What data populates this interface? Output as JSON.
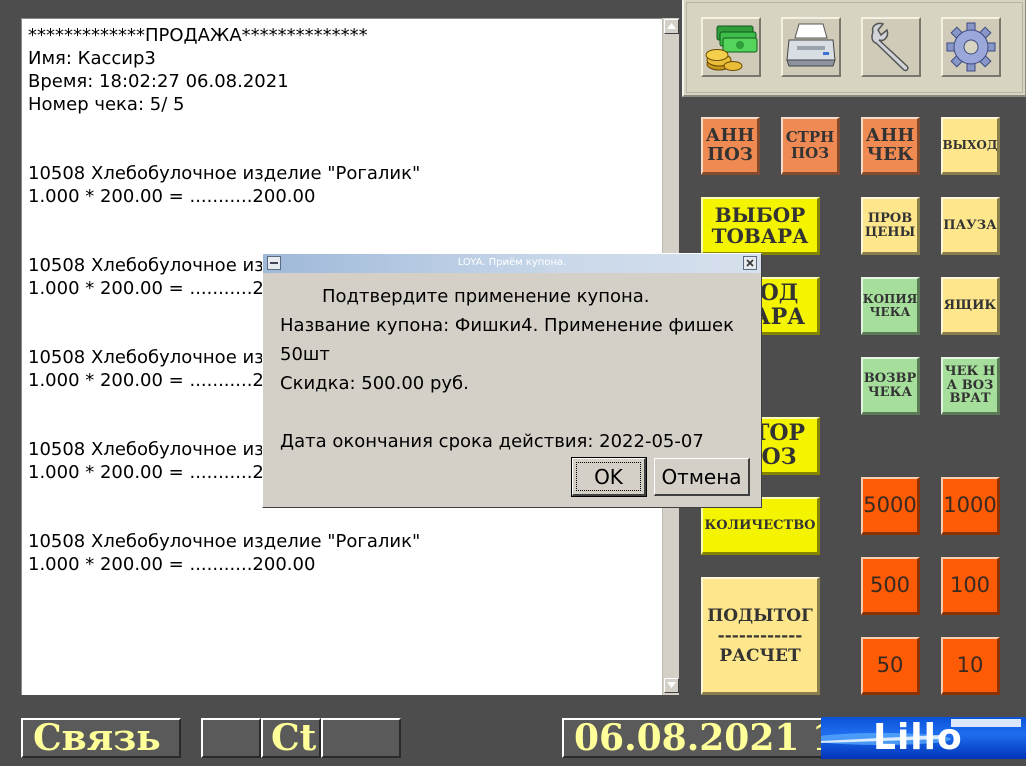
{
  "receipt": {
    "lines": [
      "*************ПРОДАЖА**************",
      "Имя: Кассир3",
      "Время: 18:02:27 06.08.2021",
      "Номер чека: 5/ 5",
      "",
      "",
      "10508 Хлебобулочное изделие \"Рогалик\"",
      "1.000 * 200.00 = ...........200.00",
      "",
      "",
      "10508 Хлебобулочное изделие \"Рогалик\"",
      "1.000 * 200.00 = ...........200.00",
      "",
      "",
      "10508 Хлебобулочное изделие \"Рогалик\"",
      "1.000 * 200.00 = ...........200.00",
      "",
      "",
      "10508 Хлебобулочное изделие \"Рогалик\"",
      "1.000 * 200.00 = ...........200.00",
      "",
      "",
      "10508 Хлебобулочное изделие \"Рогалик\"",
      "1.000 * 200.00 = ...........200.00"
    ]
  },
  "toolbar_icons": [
    "money-icon",
    "printer-icon",
    "wrench-icon",
    "gear-icon"
  ],
  "buttons": {
    "ann_poz": "АНН ПОЗ",
    "strn_poz": "СТРН ПОЗ",
    "ann_chek": "АНН ЧЕК",
    "exit": "ВЫХОД",
    "select_goods": "ВЫБОР ТОВАРА",
    "check_price": "ПРОВ ЦЕНЫ",
    "pause": "ПАУЗА",
    "input_goods": "ОД АРА",
    "copy_receipt": "КОПИЯ ЧЕКА",
    "drawer": "ЯЩИК",
    "return_receipt": "ВОЗВР ЧЕКА",
    "return_by_receipt": "ЧЕК Н А ВОЗ ВРАТ",
    "repeat_poz": "ТОР ОЗ",
    "quantity": "КОЛИЧЕСТВО",
    "subtotal": "ПОДЫТОГ",
    "subtotal_separator": "------------",
    "payment": "РАСЧЕТ",
    "bill_5000": "5000",
    "bill_1000": "1000",
    "bill_500": "500",
    "bill_100": "100",
    "bill_50": "50",
    "bill_10": "10"
  },
  "status_bar": {
    "connection": "Связь",
    "slot2": "",
    "slot3": "Ct",
    "slot4": "",
    "date": "06.08.2021 1"
  },
  "logo_text": "Lillo",
  "dialog": {
    "title": "LOYA. Приём купона.",
    "line1": "Подтвердите применение купона.",
    "line2": "Название купона: Фишки4. Применение фишек",
    "line3": "50шт",
    "line4": "Скидка: 500.00 руб.",
    "line5": "Дата окончания срока действия: 2022-05-07",
    "ok": "OK",
    "cancel": "Отмена"
  },
  "colors": {
    "background": "#4d4d4d",
    "orange": "#ef8a52",
    "pale_yellow": "#fde68c",
    "yellow": "#f4f300",
    "green": "#a6df9c",
    "red": "#fd5b05",
    "status_text": "#ffff9a"
  }
}
